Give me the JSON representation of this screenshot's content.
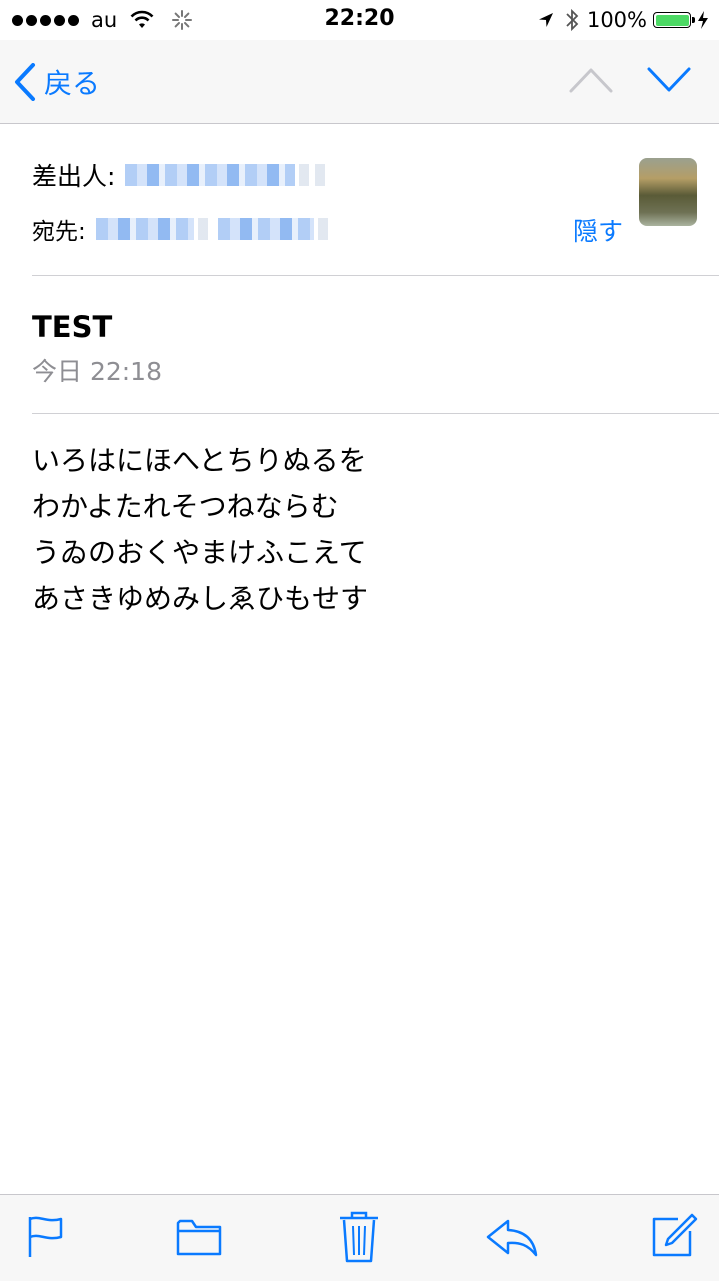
{
  "status_bar": {
    "carrier": "au",
    "time": "22:20",
    "battery_percent": "100%",
    "battery_level": 1.0,
    "icons": [
      "signal-dots",
      "wifi-icon",
      "loading-icon",
      "location-arrow-icon",
      "bluetooth-icon",
      "battery-icon",
      "charging-bolt-icon"
    ]
  },
  "nav": {
    "back_label": "戻る",
    "icons": [
      "chevron-left-icon",
      "chevron-up-icon",
      "chevron-down-icon"
    ]
  },
  "header": {
    "from_label": "差出人:",
    "to_label": "宛先:",
    "hide_label": "隠す"
  },
  "message": {
    "subject": "TEST",
    "date": "今日 22:18",
    "body_lines": [
      "いろはにほへとちりぬるを",
      "わかよたれそつねならむ",
      "うゐのおくやまけふこえて",
      "あさきゆめみしゑひもせす"
    ]
  },
  "toolbar": {
    "icons": [
      "flag-icon",
      "folder-icon",
      "trash-icon",
      "reply-icon",
      "compose-icon"
    ]
  },
  "colors": {
    "accent": "#0a7aff",
    "battery": "#4cd964",
    "secondary_text": "#8e8e93"
  }
}
